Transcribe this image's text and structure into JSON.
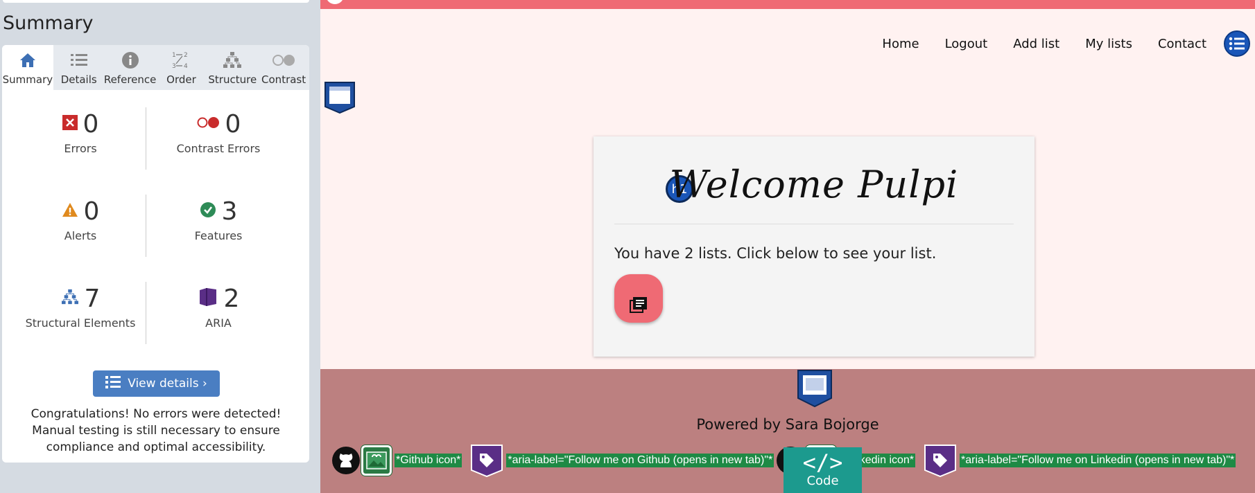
{
  "sidebar": {
    "title": "Summary",
    "tabs": [
      {
        "label": "Summary",
        "icon": "home-icon"
      },
      {
        "label": "Details",
        "icon": "list-icon"
      },
      {
        "label": "Reference",
        "icon": "info-icon"
      },
      {
        "label": "Order",
        "icon": "order-icon"
      },
      {
        "label": "Structure",
        "icon": "structure-icon"
      },
      {
        "label": "Contrast",
        "icon": "contrast-icon"
      }
    ],
    "stats": {
      "errors": {
        "value": "0",
        "label": "Errors"
      },
      "contrast_errors": {
        "value": "0",
        "label": "Contrast Errors"
      },
      "alerts": {
        "value": "0",
        "label": "Alerts"
      },
      "features": {
        "value": "3",
        "label": "Features"
      },
      "structural": {
        "value": "7",
        "label": "Structural Elements"
      },
      "aria": {
        "value": "2",
        "label": "ARIA"
      }
    },
    "view_details_label": "View details ›",
    "congrats": "Congratulations! No errors were detected! Manual testing is still necessary to ensure compliance and optimal accessibility."
  },
  "nav": {
    "items": [
      "Home",
      "Logout",
      "Add list",
      "My lists",
      "Contact"
    ]
  },
  "card": {
    "h1_badge": "h1",
    "heading": "Welcome Pulpi",
    "message": "You have 2 lists. Click below to see your list."
  },
  "footer": {
    "powered": "Powered by Sara Bojorge",
    "github_alt": "*Github icon*",
    "github_aria": "*aria-label=\"Follow me on Github (opens in new tab)\"*",
    "linkedin_alt": "*Linkedin icon*",
    "linkedin_aria": "*aria-label=\"Follow me on Linkedin (opens in new tab)\"*"
  },
  "code_button": {
    "symbol": "</>",
    "label": "Code"
  },
  "colors": {
    "accent_pink": "#ef6a74",
    "footer_bg": "#bc8080",
    "page_bg": "#fff2f1",
    "wave_blue": "#4a7ec2",
    "aria_purple": "#5a2e86",
    "alt_green": "#1e8a45"
  }
}
